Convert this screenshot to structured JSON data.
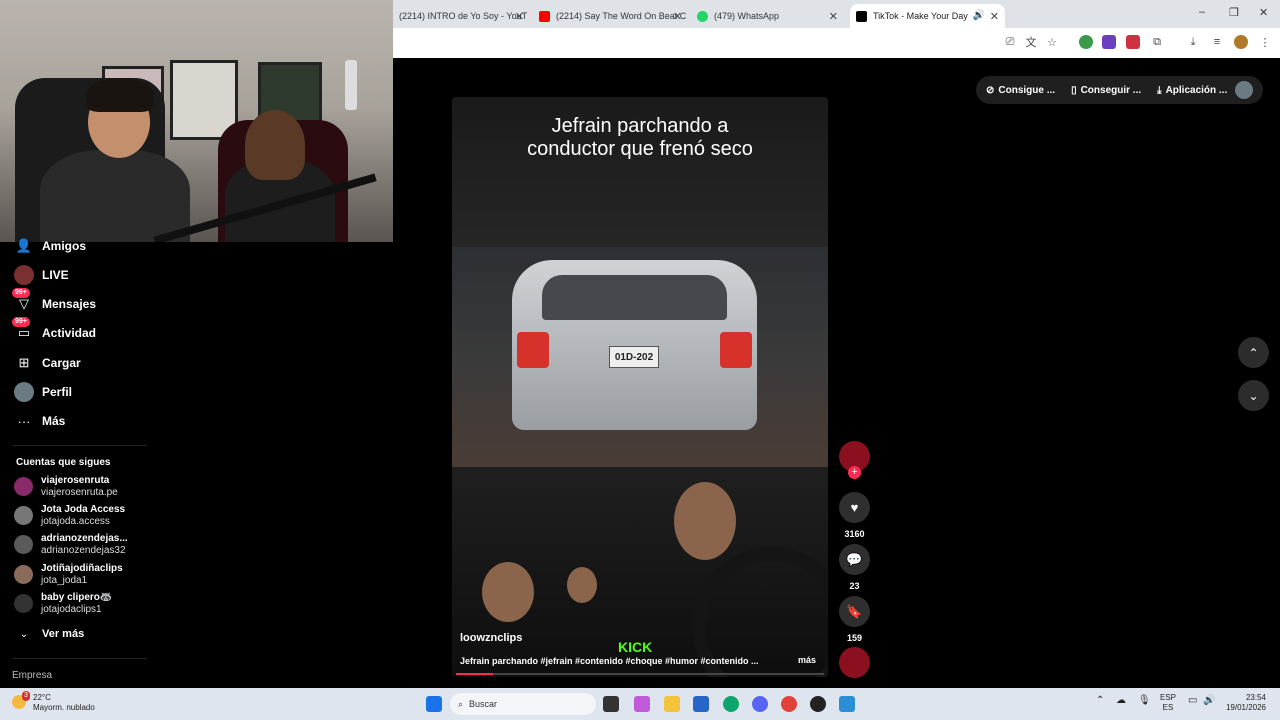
{
  "browser": {
    "tabs": [
      {
        "title": "(2214) INTRO de Yo Soy - YouT",
        "color": "#ff0000"
      },
      {
        "title": "(2214) Say The Word On Beat C",
        "color": "#ff0000"
      },
      {
        "title": "(479) WhatsApp",
        "color": "#25d366"
      },
      {
        "title": "TikTok - Make Your Day",
        "color": "#000000"
      }
    ],
    "new_tab": "+",
    "window_controls": [
      "–",
      "❐",
      "✕"
    ]
  },
  "sidebar": {
    "items": [
      {
        "label": "Amigos",
        "icon": "friends-icon"
      },
      {
        "label": "LIVE",
        "icon": "live-icon"
      },
      {
        "label": "Mensajes",
        "icon": "messages-icon",
        "badge": "99+"
      },
      {
        "label": "Actividad",
        "icon": "activity-icon",
        "badge": "99+"
      },
      {
        "label": "Cargar",
        "icon": "upload-icon"
      },
      {
        "label": "Perfil",
        "icon": "profile-icon"
      },
      {
        "label": "Más",
        "icon": "more-icon"
      }
    ],
    "following_title": "Cuentas que sigues",
    "following": [
      {
        "name": "viajerosenruta",
        "handle": "viajerosenruta.pe"
      },
      {
        "name": "Jota Joda Access",
        "handle": "jotajoda.access"
      },
      {
        "name": "adrianozendejas...",
        "handle": "adrianozendejas32"
      },
      {
        "name": "Jotiñajodiñaclips",
        "handle": "jota_joda1"
      },
      {
        "name": "baby clipero🦝",
        "handle": "jotajodaclips1"
      }
    ],
    "see_more": "Ver más",
    "footer": "Empresa"
  },
  "topbar": {
    "get_coins": "Consigue ...",
    "get_app": "Conseguir ...",
    "app": "Aplicación ..."
  },
  "video": {
    "caption_line1": "Jefrain parchando a",
    "caption_line2": "conductor que frenó seco",
    "plate": "01D-202",
    "author": "loowznclips",
    "description": "Jefrain parchando #jefrain #contenido #choque #humor #contenido ...",
    "more": "más",
    "watermark": "KICK",
    "progress": 0.1
  },
  "actions": {
    "likes": "3160",
    "comments": "23",
    "saves": "159"
  },
  "taskbar": {
    "temp": "22°C",
    "weather": "Mayorm. nublado",
    "weather_badge": "3",
    "search_placeholder": "Buscar",
    "lang1": "ESP",
    "lang2": "ES",
    "time": "23:54",
    "date": "19/01/2026"
  }
}
